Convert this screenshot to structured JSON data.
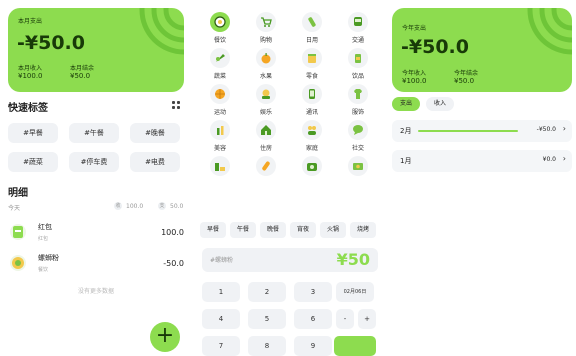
{
  "colors": {
    "accent": "#8ddc4f",
    "chip_bg": "#f0f2f5",
    "dark_text": "#183a08"
  },
  "overview": {
    "month_label": "本月支出",
    "month_expense": "-¥50.0",
    "income_label": "本月收入",
    "income_value": "¥100.0",
    "balance_label": "本月结余",
    "balance_value": "¥50.0"
  },
  "quick_tags": {
    "title": "快速标签",
    "items": [
      "#早餐",
      "#午餐",
      "#晚餐",
      "#蔬菜",
      "#停车费",
      "#电费"
    ]
  },
  "detail": {
    "title": "明细",
    "day_label": "今天",
    "day_income_badge": "收",
    "day_income": "100.0",
    "day_expense_badge": "支",
    "day_expense": "50.0",
    "records": [
      {
        "icon": "red-envelope-icon",
        "name": "红包",
        "category": "红包",
        "amount": "100.0"
      },
      {
        "icon": "noodle-bowl-icon",
        "name": "螺蛳粉",
        "category": "餐饮",
        "amount": "-50.0"
      }
    ],
    "no_more": "没有更多数据"
  },
  "fab_label": "+",
  "categories": [
    {
      "label": "餐饮",
      "icon": "food-icon",
      "selected": true
    },
    {
      "label": "购物",
      "icon": "cart-icon"
    },
    {
      "label": "日用",
      "icon": "bottle-icon"
    },
    {
      "label": "交通",
      "icon": "bus-icon"
    },
    {
      "label": "蔬菜",
      "icon": "vegetable-icon"
    },
    {
      "label": "水果",
      "icon": "fruit-icon"
    },
    {
      "label": "零食",
      "icon": "snack-icon"
    },
    {
      "label": "饮品",
      "icon": "drink-icon"
    },
    {
      "label": "运动",
      "icon": "ball-icon"
    },
    {
      "label": "娱乐",
      "icon": "entertainment-icon"
    },
    {
      "label": "通讯",
      "icon": "phone-icon"
    },
    {
      "label": "服饰",
      "icon": "shirt-icon"
    },
    {
      "label": "美容",
      "icon": "cosmetics-icon"
    },
    {
      "label": "住房",
      "icon": "house-icon"
    },
    {
      "label": "家庭",
      "icon": "family-icon"
    },
    {
      "label": "社交",
      "icon": "chat-icon"
    },
    {
      "label": "",
      "icon": "fitness-icon"
    },
    {
      "label": "",
      "icon": "medicine-icon"
    },
    {
      "label": "",
      "icon": "camera-icon"
    },
    {
      "label": "",
      "icon": "money-icon"
    }
  ],
  "tag_chips": [
    "早餐",
    "午餐",
    "晚餐",
    "宵夜",
    "火锅",
    "烧烤"
  ],
  "entry": {
    "note_placeholder": "#螺蛳粉",
    "amount": "¥50"
  },
  "keypad": {
    "keys": [
      [
        "1",
        "2",
        "3",
        "02月06日"
      ],
      [
        "4",
        "5",
        "6",
        "-",
        "+"
      ],
      [
        "7",
        "8",
        "9",
        ""
      ]
    ]
  },
  "year": {
    "expense_label": "今年支出",
    "expense": "-¥50.0",
    "income_label": "今年收入",
    "income_value": "¥100.0",
    "balance_label": "今年结余",
    "balance_value": "¥50.0",
    "tabs": [
      "支出",
      "收入"
    ],
    "months": [
      {
        "label": "2月",
        "value": "-¥50.0",
        "progress": 1.0
      },
      {
        "label": "1月",
        "value": "¥0.0",
        "progress": 0.0
      }
    ]
  }
}
